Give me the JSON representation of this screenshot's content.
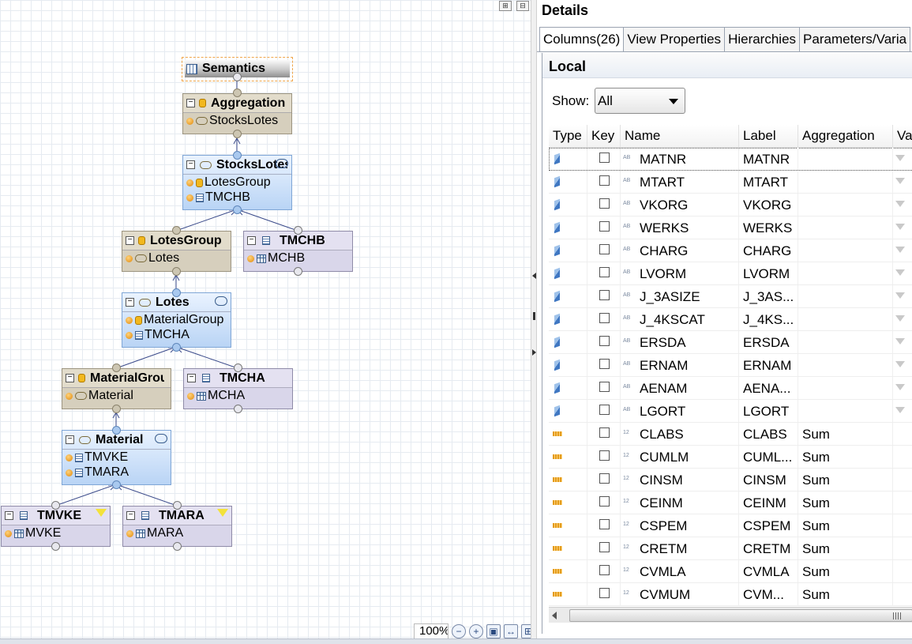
{
  "diagram": {
    "semantics": {
      "title": "Semantics"
    },
    "nodes": {
      "aggregation": {
        "title": "Aggregation",
        "rows": [
          "StocksLotes"
        ]
      },
      "stockslotes": {
        "title": "StocksLotes",
        "rows": [
          "LotesGroup",
          "TMCHB"
        ]
      },
      "lotesgroup": {
        "title": "LotesGroup",
        "rows": [
          "Lotes"
        ]
      },
      "tmchb": {
        "title": "TMCHB",
        "rows": [
          "MCHB"
        ]
      },
      "lotes": {
        "title": "Lotes",
        "rows": [
          "MaterialGroup",
          "TMCHA"
        ]
      },
      "materialgroup": {
        "title": "MaterialGroup",
        "rows": [
          "Material"
        ]
      },
      "tmcha": {
        "title": "TMCHA",
        "rows": [
          "MCHA"
        ]
      },
      "material": {
        "title": "Material",
        "rows": [
          "TMVKE",
          "TMARA"
        ]
      },
      "tmvke": {
        "title": "TMVKE",
        "rows": [
          "MVKE"
        ]
      },
      "tmara": {
        "title": "TMARA",
        "rows": [
          "MARA"
        ]
      }
    },
    "zoom": "100%",
    "icons": {
      "zoom_out": "zoom-out-icon",
      "zoom_in": "zoom-in-icon",
      "fit": "fit-icon",
      "auto_layout": "auto-layout-icon"
    }
  },
  "details": {
    "title": "Details",
    "tabs": [
      "Columns(26)",
      "View Properties",
      "Hierarchies",
      "Parameters/Varia"
    ],
    "section": "Local",
    "show": {
      "label": "Show:",
      "value": "All"
    },
    "columns": [
      "Type",
      "Key",
      "Name",
      "Label",
      "Aggregation",
      "Va"
    ],
    "rows": [
      {
        "type": "attribute",
        "dtype": "AB",
        "name": "MATNR",
        "label": "MATNR",
        "aggregation": ""
      },
      {
        "type": "attribute",
        "dtype": "AB",
        "name": "MTART",
        "label": "MTART",
        "aggregation": ""
      },
      {
        "type": "attribute",
        "dtype": "AB",
        "name": "VKORG",
        "label": "VKORG",
        "aggregation": ""
      },
      {
        "type": "attribute",
        "dtype": "AB",
        "name": "WERKS",
        "label": "WERKS",
        "aggregation": ""
      },
      {
        "type": "attribute",
        "dtype": "AB",
        "name": "CHARG",
        "label": "CHARG",
        "aggregation": ""
      },
      {
        "type": "attribute",
        "dtype": "AB",
        "name": "LVORM",
        "label": "LVORM",
        "aggregation": ""
      },
      {
        "type": "attribute",
        "dtype": "AB",
        "name": "J_3ASIZE",
        "label": "J_3AS...",
        "aggregation": ""
      },
      {
        "type": "attribute",
        "dtype": "AB",
        "name": "J_4KSCAT",
        "label": "J_4KS...",
        "aggregation": ""
      },
      {
        "type": "attribute",
        "dtype": "AB",
        "name": "ERSDA",
        "label": "ERSDA",
        "aggregation": ""
      },
      {
        "type": "attribute",
        "dtype": "AB",
        "name": "ERNAM",
        "label": "ERNAM",
        "aggregation": ""
      },
      {
        "type": "attribute",
        "dtype": "AB",
        "name": "AENAM",
        "label": "AENA...",
        "aggregation": ""
      },
      {
        "type": "attribute",
        "dtype": "AB",
        "name": "LGORT",
        "label": "LGORT",
        "aggregation": ""
      },
      {
        "type": "measure",
        "dtype": "12",
        "name": "CLABS",
        "label": "CLABS",
        "aggregation": "Sum"
      },
      {
        "type": "measure",
        "dtype": "12",
        "name": "CUMLM",
        "label": "CUML...",
        "aggregation": "Sum"
      },
      {
        "type": "measure",
        "dtype": "12",
        "name": "CINSM",
        "label": "CINSM",
        "aggregation": "Sum"
      },
      {
        "type": "measure",
        "dtype": "12",
        "name": "CEINM",
        "label": "CEINM",
        "aggregation": "Sum"
      },
      {
        "type": "measure",
        "dtype": "12",
        "name": "CSPEM",
        "label": "CSPEM",
        "aggregation": "Sum"
      },
      {
        "type": "measure",
        "dtype": "12",
        "name": "CRETM",
        "label": "CRETM",
        "aggregation": "Sum"
      },
      {
        "type": "measure",
        "dtype": "12",
        "name": "CVMLA",
        "label": "CVMLA",
        "aggregation": "Sum"
      },
      {
        "type": "measure",
        "dtype": "12",
        "name": "CVMUM",
        "label": "CVM...",
        "aggregation": "Sum"
      }
    ]
  }
}
